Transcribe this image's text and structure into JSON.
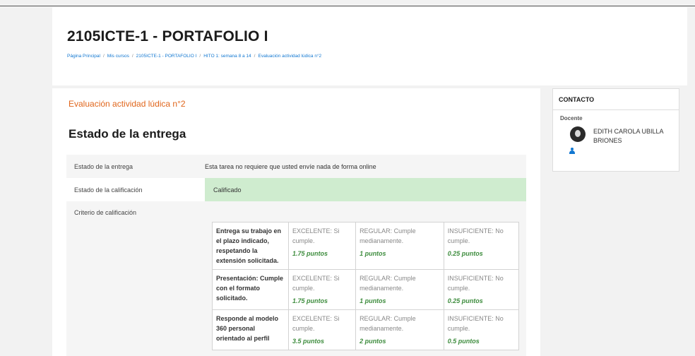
{
  "header": {
    "course_title": "2105ICTE-1 - PORTAFOLIO I",
    "breadcrumb": [
      "Página Principal",
      "Mis cursos",
      "2105ICTE-1 - PORTAFOLIO I",
      "HITO 1: semana 8 a 14",
      "Evaluación actividad lúdica n°2"
    ]
  },
  "main": {
    "activity_title": "Evaluación actividad lúdica n°2",
    "section_title": "Estado de la entrega",
    "status_rows": [
      {
        "label": "Estado de la entrega",
        "value": "Esta tarea no requiere que usted envíe nada de forma online"
      },
      {
        "label": "Estado de la calificación",
        "value": "Calificado"
      },
      {
        "label": "Criterio de calificación",
        "value": ""
      }
    ],
    "status_graded_color": "#cfeccf",
    "rubric": [
      {
        "criterion": "Entrega su trabajo en el plazo indicado, respetando la extensión solicitada.",
        "levels": [
          {
            "desc": "EXCELENTE: Si cumple.",
            "points": "1.75 puntos"
          },
          {
            "desc": "REGULAR: Cumple medianamente.",
            "points": "1 puntos"
          },
          {
            "desc": "INSUFICIENTE: No cumple.",
            "points": "0.25 puntos"
          }
        ]
      },
      {
        "criterion": "Presentación: Cumple con el formato solicitado.",
        "levels": [
          {
            "desc": "EXCELENTE: Si cumple.",
            "points": "1.75 puntos"
          },
          {
            "desc": "REGULAR: Cumple medianamente.",
            "points": "1 puntos"
          },
          {
            "desc": "INSUFICIENTE: No cumple.",
            "points": "0.25 puntos"
          }
        ]
      },
      {
        "criterion": "Responde al modelo 360 personal orientado al perfil",
        "levels": [
          {
            "desc": "EXCELENTE: Si cumple.",
            "points": "3.5 puntos"
          },
          {
            "desc": "REGULAR: Cumple medianamente.",
            "points": "2 puntos"
          },
          {
            "desc": "INSUFICIENTE: No cumple.",
            "points": "0.5 puntos"
          }
        ]
      }
    ]
  },
  "sidebar": {
    "block_title": "CONTACTO",
    "role": "Docente",
    "contact_name": "EDITH CAROLA UBILLA BRIONES",
    "avatar_icon": "avatar-photo",
    "user_icon": "user-icon"
  },
  "colors": {
    "accent_orange": "#e0651b",
    "link_blue": "#1177d1",
    "points_green": "#3d8c3d"
  }
}
